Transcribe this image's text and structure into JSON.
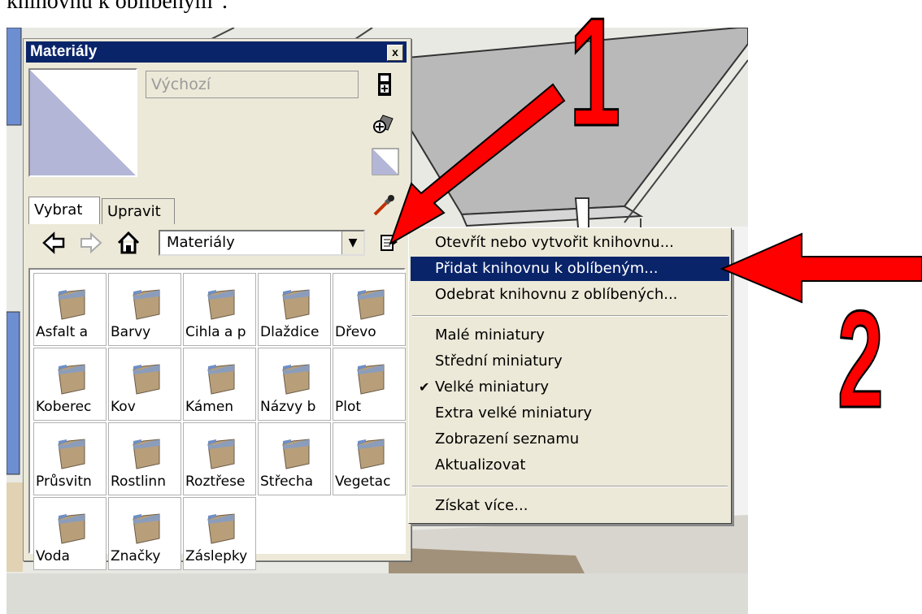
{
  "caption": "knihovnu k oblíbeným\".",
  "panel": {
    "title": "Materiály",
    "close_label": "x",
    "material_name": "Výchozí",
    "tabs": [
      {
        "label": "Vybrat",
        "active": true
      },
      {
        "label": "Upravit",
        "active": false
      }
    ],
    "library_selected": "Materiály"
  },
  "library_items": [
    "Asfalt a",
    "Barvy",
    "Cihla a p",
    "Dlaždice",
    "Dřevo",
    "Koberec",
    "Kov",
    "Kámen",
    "Názvy b",
    "Plot",
    "Průsvitn",
    "Rostlinn",
    "Roztřese",
    "Střecha",
    "Vegetac",
    "Voda",
    "Značky",
    "Záslepky"
  ],
  "menu": {
    "items": [
      {
        "label": "Otevřít nebo vytvořit knihovnu...",
        "highlighted": false,
        "checked": false
      },
      {
        "label": "Přidat knihovnu k oblíbeným...",
        "highlighted": true,
        "checked": false
      },
      {
        "label": "Odebrat knihovnu z oblíbených...",
        "highlighted": false,
        "checked": false
      },
      {
        "separator": true
      },
      {
        "label": "Malé miniatury",
        "highlighted": false,
        "checked": false
      },
      {
        "label": "Střední miniatury",
        "highlighted": false,
        "checked": false
      },
      {
        "label": "Velké miniatury",
        "highlighted": false,
        "checked": true
      },
      {
        "label": "Extra velké miniatury",
        "highlighted": false,
        "checked": false
      },
      {
        "label": "Zobrazení seznamu",
        "highlighted": false,
        "checked": false
      },
      {
        "label": "Aktualizovat",
        "highlighted": false,
        "checked": false
      },
      {
        "separator": true
      },
      {
        "label": "Získat více...",
        "highlighted": false,
        "checked": false
      }
    ]
  },
  "annotations": {
    "step1": "1",
    "step2": "2"
  },
  "icons": {
    "back": "arrow-left-icon",
    "forward": "arrow-right-icon",
    "home": "home-icon",
    "details": "details-menu-icon",
    "eyedropper": "eyedropper-icon",
    "create_material": "create-material-icon",
    "default_material": "default-material-icon"
  },
  "colors": {
    "highlight": "#0a246a",
    "annotation": "#ff0000"
  }
}
